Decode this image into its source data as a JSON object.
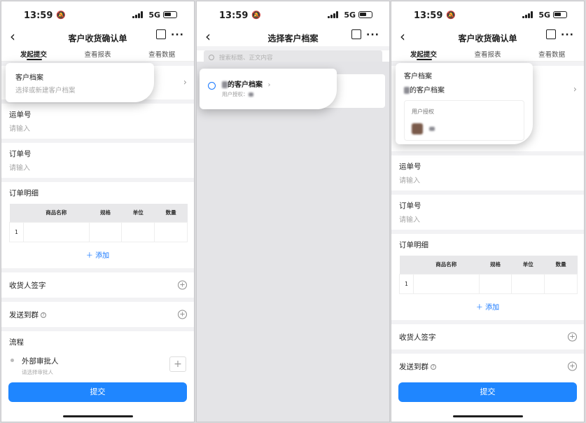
{
  "status": {
    "time": "13:59",
    "network": "5G"
  },
  "colors": {
    "accent": "#1f86ff",
    "link": "#1677ff",
    "background": "#f2f2f4"
  },
  "screen1": {
    "title": "客户收货确认单",
    "tabs": [
      "发起提交",
      "查看报表",
      "查看数据"
    ],
    "customer": {
      "label": "客户档案",
      "placeholder": "选择或新建客户档案"
    },
    "waybill": {
      "label": "运单号",
      "placeholder": "请输入"
    },
    "order": {
      "label": "订单号",
      "placeholder": "请输入"
    },
    "detail": {
      "label": "订单明细",
      "columns": [
        "商品名称",
        "规格",
        "单位",
        "数量"
      ],
      "row_index": "1",
      "add_label": "添加"
    },
    "consignee_sign": "收货人签字",
    "send_group": "发送到群",
    "flow": {
      "label": "流程",
      "approver": "外部审批人",
      "approver_placeholder": "请选择审批人"
    },
    "submit": "提交"
  },
  "screen2": {
    "title": "选择客户档案",
    "search_placeholder": "搜索标题、正文内容",
    "item": {
      "name": "的客户档案",
      "auth_label": "用户授权："
    }
  },
  "screen3": {
    "title": "客户收货确认单",
    "tabs": [
      "发起提交",
      "查看报表",
      "查看数据"
    ],
    "customer": {
      "label": "客户档案",
      "value": "的客户档案",
      "auth_label": "用户授权"
    },
    "waybill": {
      "label": "运单号",
      "placeholder": "请输入"
    },
    "order": {
      "label": "订单号",
      "placeholder": "请输入"
    },
    "detail": {
      "label": "订单明细",
      "columns": [
        "商品名称",
        "规格",
        "单位",
        "数量"
      ],
      "row_index": "1",
      "add_label": "添加"
    },
    "consignee_sign": "收货人签字",
    "send_group": "发送到群",
    "submit": "提交"
  }
}
